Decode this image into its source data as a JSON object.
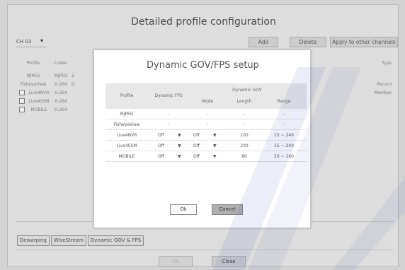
{
  "background": {
    "title": "Detailed profile configuration",
    "channel": "CH 03",
    "buttons": {
      "add": "Add",
      "delete": "Delete",
      "apply": "Apply to other channels"
    },
    "columns": {
      "profile": "Profile",
      "codec": "Codec",
      "type": "Type"
    },
    "rows": [
      {
        "profile": "MJPEG",
        "codec": "MJPEG",
        "extra": "2",
        "type": "",
        "checkbox": false
      },
      {
        "profile": "FisheyeView",
        "codec": "H.264",
        "extra": "D",
        "type": "Record",
        "checkbox": false
      },
      {
        "profile": "Live4NVR",
        "codec": "H.264",
        "extra": "",
        "type": "Member",
        "checkbox": true
      },
      {
        "profile": "Live4SSM",
        "codec": "H.264",
        "extra": "",
        "type": "",
        "checkbox": true
      },
      {
        "profile": "MOBILE",
        "codec": "H.264",
        "extra": "",
        "type": "",
        "checkbox": true
      }
    ],
    "tabs": [
      "Dewarping",
      "WiseStream",
      "Dynamic GOV & FPS"
    ],
    "bottom_buttons": {
      "ok": "Ok",
      "close": "Close"
    }
  },
  "modal": {
    "title": "Dynamic GOV/FPS setup",
    "headers": {
      "profile": "Profile",
      "fps": "Dynamic FPS",
      "gov": "Dynamic GOV",
      "mode": "Mode",
      "length": "Length",
      "range": "Range"
    },
    "rows": [
      {
        "profile": "MJPEG",
        "fps": "-",
        "mode": "-",
        "length": "-",
        "range": "-",
        "has_dropdown": false
      },
      {
        "profile": "FisheyeView",
        "fps": "-",
        "mode": "-",
        "length": "-",
        "range": "-",
        "has_dropdown": false
      },
      {
        "profile": "Live4NVR",
        "fps": "Off",
        "mode": "Off",
        "length": "200",
        "range": "15 ~ 240",
        "has_dropdown": true
      },
      {
        "profile": "Live4SSM",
        "fps": "Off",
        "mode": "Off",
        "length": "200",
        "range": "15 ~ 240",
        "has_dropdown": true
      },
      {
        "profile": "MOBILE",
        "fps": "Off",
        "mode": "Off",
        "length": "80",
        "range": "20 ~ 160",
        "has_dropdown": true
      }
    ],
    "buttons": {
      "ok": "Ok",
      "cancel": "Cancel"
    }
  },
  "colors": {
    "modal_bg": "#ffffff",
    "cancel_bg": "#b0b0b0",
    "header_bg": "#e8e8e8"
  }
}
